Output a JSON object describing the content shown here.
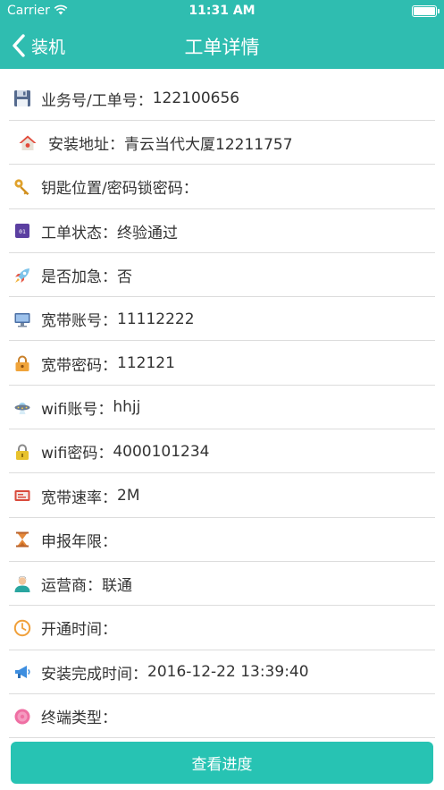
{
  "status_bar": {
    "carrier": "Carrier",
    "time": "11:31 AM"
  },
  "nav": {
    "back_label": "装机",
    "title": "工单详情"
  },
  "rows": [
    {
      "label": "业务号/工单号：",
      "value": "122100656",
      "icon": "floppy-disk-icon"
    },
    {
      "label": "安装地址：",
      "value": "青云当代大厦12211757",
      "icon": "house-icon"
    },
    {
      "label": "钥匙位置/密码锁密码：",
      "value": "",
      "icon": "key-icon"
    },
    {
      "label": "工单状态：",
      "value": "终验通过",
      "icon": "status-box-icon"
    },
    {
      "label": "是否加急：",
      "value": "否",
      "icon": "rocket-icon"
    },
    {
      "label": "宽带账号：",
      "value": "11112222",
      "icon": "monitor-icon"
    },
    {
      "label": "宽带密码：",
      "value": "112121",
      "icon": "lock-icon"
    },
    {
      "label": "wifi账号：",
      "value": "hhjj",
      "icon": "ufo-icon"
    },
    {
      "label": "wifi密码：",
      "value": "4000101234",
      "icon": "padlock-icon"
    },
    {
      "label": "宽带速率：",
      "value": "2M",
      "icon": "router-icon"
    },
    {
      "label": "申报年限：",
      "value": "",
      "icon": "hourglass-icon"
    },
    {
      "label": "运营商：",
      "value": "联通",
      "icon": "person-icon"
    },
    {
      "label": "开通时间：",
      "value": "",
      "icon": "clock-icon"
    },
    {
      "label": "安装完成时间：",
      "value": "2016-12-22 13:39:40",
      "icon": "megaphone-icon"
    },
    {
      "label": "终端类型：",
      "value": "",
      "icon": "circle-badge-icon"
    }
  ],
  "footer": {
    "button_label": "查看进度"
  },
  "colors": {
    "accent": "#2fbdb0",
    "button": "#27c3b3",
    "divider": "#dcdcdc"
  }
}
